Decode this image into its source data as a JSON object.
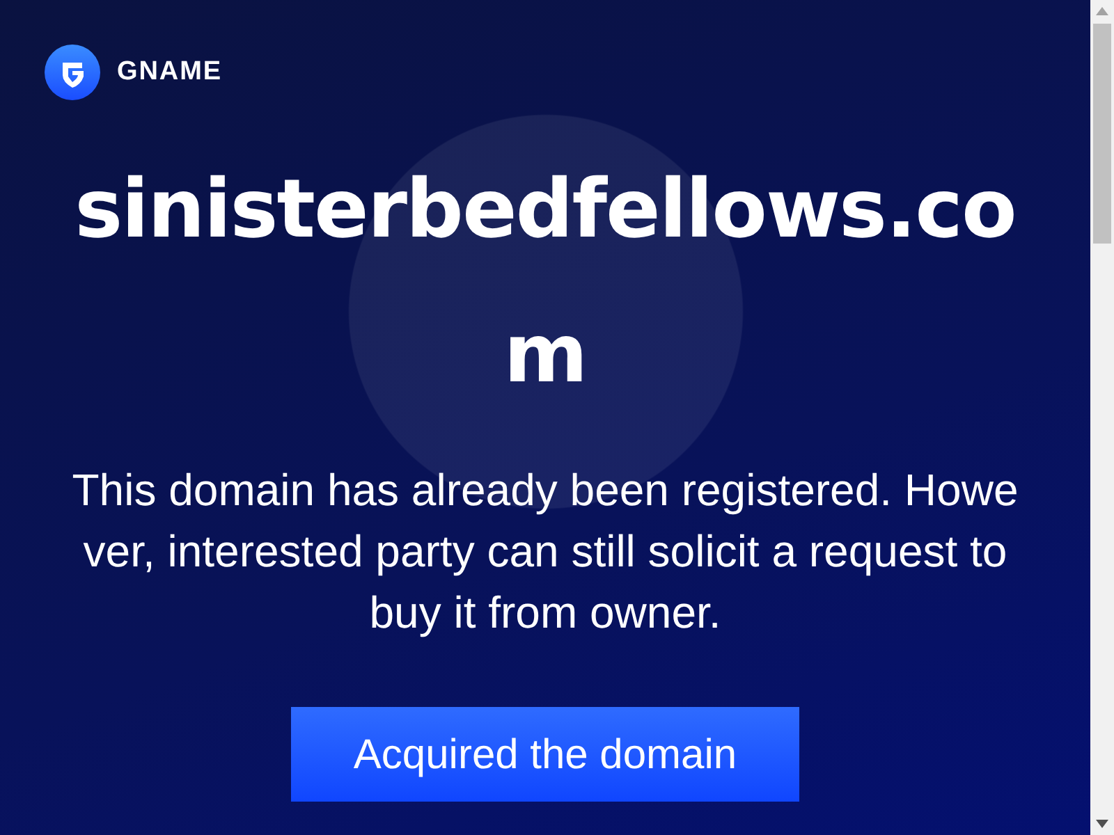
{
  "brand": {
    "name": "GNAME"
  },
  "domain": "sinisterbedfellows.com",
  "message": "This domain has already been registered. However, interested party can still solicit a request to buy it from owner.",
  "button": {
    "label": "Acquired the domain"
  }
}
